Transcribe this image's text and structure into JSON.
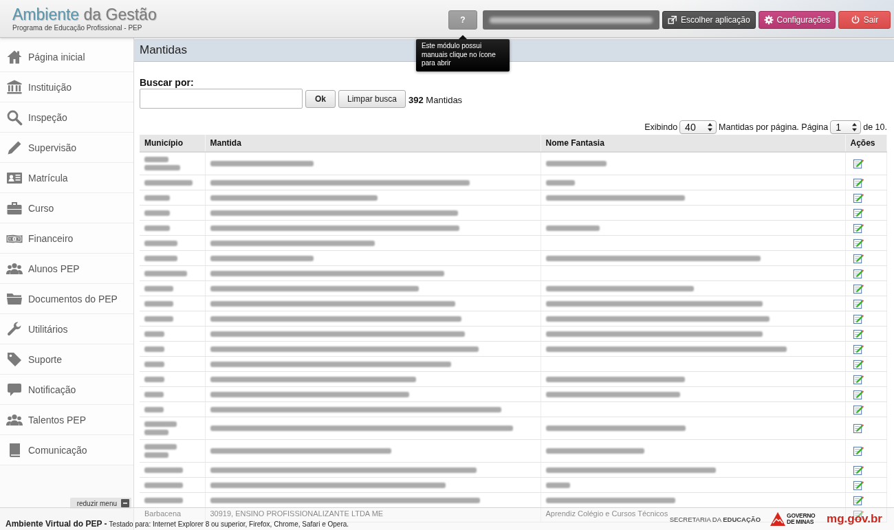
{
  "header": {
    "logo_primary": "Ambiente",
    "logo_secondary": "da Gestão",
    "subtitle": "Programa de Educação Profissional - PEP",
    "help_button": "?",
    "buttons": [
      {
        "kind": "switch-app",
        "label": "Escolher aplicação"
      },
      {
        "kind": "settings",
        "label": "Configurações"
      },
      {
        "kind": "logout",
        "label": "Sair"
      }
    ]
  },
  "tooltip": {
    "text": "Este módulo possui manuais clique no ícone para abrir"
  },
  "sidebar": {
    "items": [
      {
        "kind": "home",
        "label": "Página inicial"
      },
      {
        "kind": "institution",
        "label": "Instituição"
      },
      {
        "kind": "inspection",
        "label": "Inspeção"
      },
      {
        "kind": "supervision",
        "label": "Supervisão"
      },
      {
        "kind": "enrollment",
        "label": "Matrícula"
      },
      {
        "kind": "course",
        "label": "Curso"
      },
      {
        "kind": "finance",
        "label": "Financeiro"
      },
      {
        "kind": "students",
        "label": "Alunos PEP"
      },
      {
        "kind": "documents",
        "label": "Documentos do PEP"
      },
      {
        "kind": "utilities",
        "label": "Utilitários"
      },
      {
        "kind": "support",
        "label": "Suporte"
      },
      {
        "kind": "notification",
        "label": "Notificação"
      },
      {
        "kind": "talents",
        "label": "Talentos PEP"
      },
      {
        "kind": "communication",
        "label": "Comunicação"
      }
    ],
    "collapse_button": "reduzir menu"
  },
  "page": {
    "title": "Mantidas",
    "search": {
      "label": "Buscar por:",
      "ok_button": "Ok",
      "clear_button": "Limpar busca",
      "result_count": "**392** Mantidas"
    },
    "pagination": {
      "showing_label": "Exibindo",
      "per_page": "40",
      "per_page_label": "Mantidas por página. Página",
      "page": "1",
      "total_label": "de 10."
    }
  },
  "table": {
    "columns": [
      "Município",
      "Mantida",
      "Nome Fantasia",
      "Ações"
    ],
    "rows": [
      {
        "kind": "redacted",
        "municipio_wrapped": true,
        "trade_name_shown": true
      },
      {
        "kind": "redacted",
        "municipio_wrapped": false,
        "trade_name_shown": true
      },
      {
        "kind": "redacted",
        "municipio_wrapped": false,
        "trade_name_shown": true
      },
      {
        "kind": "redacted",
        "municipio_wrapped": false,
        "trade_name_shown": false
      },
      {
        "kind": "redacted",
        "municipio_wrapped": false,
        "trade_name_shown": true
      },
      {
        "kind": "redacted",
        "municipio_wrapped": false,
        "trade_name_shown": false
      },
      {
        "kind": "redacted",
        "municipio_wrapped": false,
        "trade_name_shown": true
      },
      {
        "kind": "redacted",
        "municipio_wrapped": false,
        "trade_name_shown": false
      },
      {
        "kind": "redacted",
        "municipio_wrapped": false,
        "trade_name_shown": true
      },
      {
        "kind": "redacted",
        "municipio_wrapped": false,
        "trade_name_shown": true
      },
      {
        "kind": "redacted",
        "municipio_wrapped": false,
        "trade_name_shown": true
      },
      {
        "kind": "redacted",
        "municipio_wrapped": false,
        "trade_name_shown": true
      },
      {
        "kind": "redacted",
        "municipio_wrapped": false,
        "trade_name_shown": true
      },
      {
        "kind": "redacted",
        "municipio_wrapped": false,
        "trade_name_shown": false
      },
      {
        "kind": "redacted",
        "municipio_wrapped": false,
        "trade_name_shown": true
      },
      {
        "kind": "redacted",
        "municipio_wrapped": false,
        "trade_name_shown": true
      },
      {
        "kind": "redacted",
        "municipio_wrapped": false,
        "trade_name_shown": false
      },
      {
        "kind": "redacted",
        "municipio_wrapped": true,
        "trade_name_shown": true
      },
      {
        "kind": "redacted",
        "municipio_wrapped": true,
        "trade_name_shown": true
      },
      {
        "kind": "redacted",
        "municipio_wrapped": false,
        "trade_name_shown": true
      },
      {
        "kind": "redacted",
        "municipio_wrapped": false,
        "trade_name_shown": true
      },
      {
        "kind": "redacted",
        "municipio_wrapped": false,
        "trade_name_shown": true
      },
      {
        "kind": "text",
        "municipio": "Barbacena",
        "mantida": "30919, ENSINO PROFISSIONALIZANTE LTDA ME",
        "nome_fantasia": "Aprendiz Colégio e Cursos Técnicos"
      }
    ]
  },
  "footer": {
    "title": "Ambiente Virtual do PEP -",
    "note": "Testado para: Internet Explorer 8 ou superior, Firefox, Chrome, Safari e Opera.",
    "department": "SECRETARIA DA **EDUCAÇÃO**",
    "government_logo": "GOVERNO DE MINAS",
    "site": "mg.gov.br"
  }
}
